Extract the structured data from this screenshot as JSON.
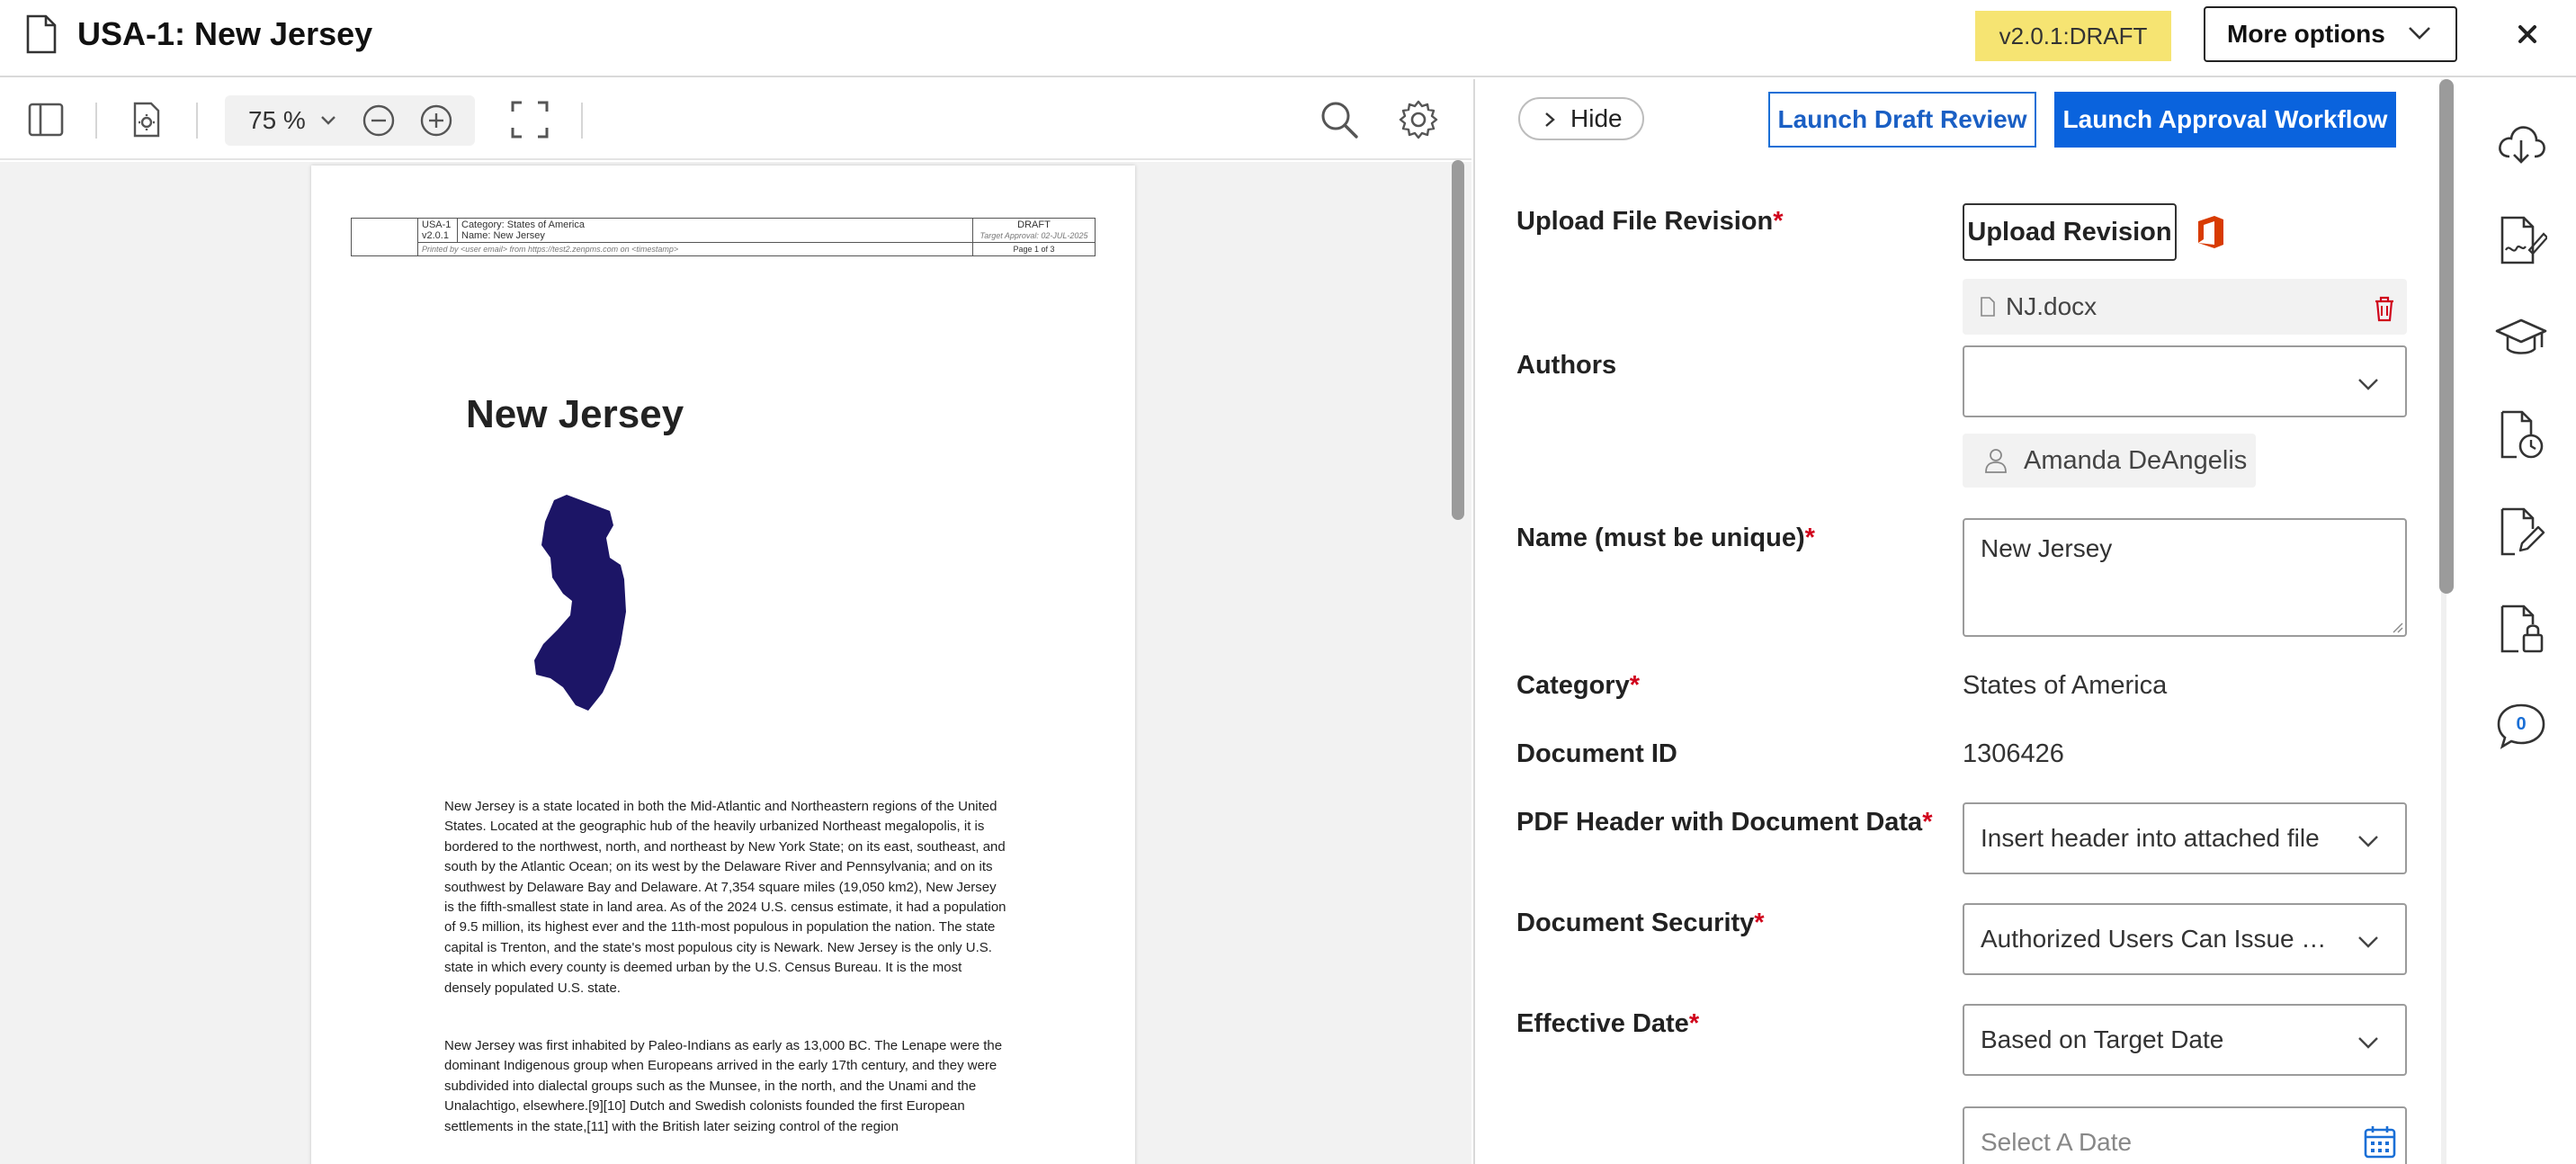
{
  "header": {
    "title": "USA-1: New Jersey",
    "version_badge": "v2.0.1:DRAFT",
    "more_options_label": "More options"
  },
  "viewer_toolbar": {
    "zoom_value": "75 %"
  },
  "document": {
    "header_table": {
      "doc_code": "USA-1",
      "doc_version": "v2.0.1",
      "category_label": "Category:",
      "category_value": "States of America",
      "name_label": "Name:",
      "name_value": "New Jersey",
      "status": "DRAFT",
      "target_approval": "Target Approval: 02-JUL-2025",
      "printed_by": "Printed by <user email> from https://test2.zenpms.com on <timestamp>",
      "page_info": "Page 1 of 3"
    },
    "title": "New Jersey",
    "paragraph_1": "New Jersey is a state located in both the Mid-Atlantic and Northeastern regions of the United States. Located at the geographic hub of the heavily urbanized Northeast megalopolis, it is bordered to the northwest, north, and northeast by New York State; on its east, southeast, and south by the Atlantic Ocean; on its west by the Delaware River and Pennsylvania; and on its southwest by Delaware Bay and Delaware. At 7,354 square miles (19,050 km2), New Jersey is the fifth-smallest state in land area. As of the 2024 U.S. census estimate, it had a population of 9.5 million, its highest ever and the 11th-most populous in population the nation. The state capital is Trenton, and the state's most populous city is Newark. New Jersey is the only U.S. state in which every county is deemed urban by the U.S. Census Bureau. It is the most densely populated U.S. state.",
    "paragraph_2": "New Jersey was first inhabited by Paleo-Indians as early as 13,000 BC. The Lenape were the dominant Indigenous group when Europeans arrived in the early 17th century, and they were subdivided into dialectal groups such as the Munsee, in the north, and the Unami and the Unalachtigo, elsewhere.[9][10] Dutch and Swedish colonists founded the first European settlements in the state,[11] with the British later seizing control of the region"
  },
  "panel": {
    "hide_label": "Hide",
    "draft_review_label": "Launch Draft Review",
    "approval_label": "Launch Approval Workflow",
    "required_mark": "*",
    "upload": {
      "label": "Upload File Revision",
      "button": "Upload Revision",
      "file_name": "NJ.docx"
    },
    "authors": {
      "label": "Authors",
      "selected_value": "",
      "user_chip": "Amanda DeAngelis"
    },
    "name": {
      "label": "Name (must be unique)",
      "value": "New Jersey"
    },
    "category": {
      "label": "Category",
      "value": "States of America"
    },
    "document_id": {
      "label": "Document ID",
      "value": "1306426"
    },
    "pdf_header": {
      "label": "PDF Header with Document Data",
      "value": "Insert header into attached file"
    },
    "security": {
      "label": "Document Security",
      "value": "Authorized Users Can Issue Copies"
    },
    "effective_date": {
      "label": "Effective Date",
      "value": "Based on Target Date",
      "date_placeholder": "Select A Date"
    }
  },
  "rail": {
    "comment_count": "0"
  },
  "colors": {
    "accent_blue": "#0a63dd",
    "badge_yellow": "#f6e472",
    "required_red": "#d0021b",
    "map_navy": "#1c1566",
    "office_orange": "#d83b01"
  },
  "icons": {
    "header": [
      "document-icon",
      "chevron-down-icon",
      "close-icon"
    ],
    "toolbar": [
      "sidebar-toggle-icon",
      "page-settings-icon",
      "zoom-out-icon",
      "zoom-in-icon",
      "fullscreen-icon",
      "search-icon",
      "gear-icon"
    ],
    "rail": [
      "cloud-download-icon",
      "signature-icon",
      "training-icon",
      "history-icon",
      "edit-document-icon",
      "lock-document-icon",
      "comment-icon"
    ]
  }
}
